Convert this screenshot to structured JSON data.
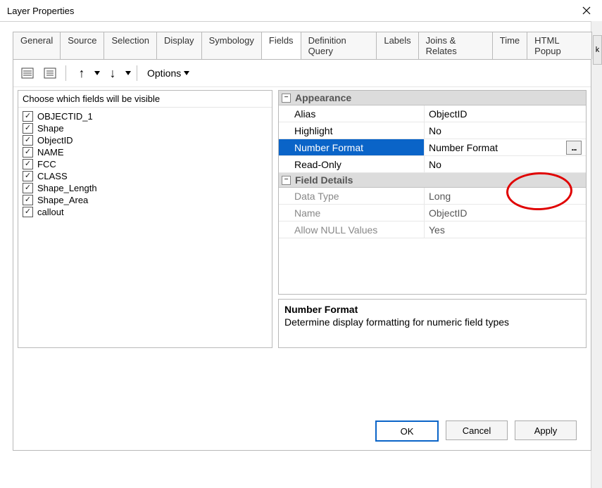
{
  "window": {
    "title": "Layer Properties"
  },
  "tabs": [
    "General",
    "Source",
    "Selection",
    "Display",
    "Symbology",
    "Fields",
    "Definition Query",
    "Labels",
    "Joins & Relates",
    "Time",
    "HTML Popup"
  ],
  "active_tab_index": 5,
  "toolbar": {
    "options_label": "Options"
  },
  "left": {
    "header": "Choose which fields will be visible",
    "fields": [
      {
        "checked": true,
        "name": "OBJECTID_1"
      },
      {
        "checked": true,
        "name": "Shape"
      },
      {
        "checked": true,
        "name": "ObjectID"
      },
      {
        "checked": true,
        "name": "NAME"
      },
      {
        "checked": true,
        "name": "FCC"
      },
      {
        "checked": true,
        "name": "CLASS"
      },
      {
        "checked": true,
        "name": "Shape_Length"
      },
      {
        "checked": true,
        "name": "Shape_Area"
      },
      {
        "checked": true,
        "name": "callout"
      }
    ]
  },
  "propgrid": {
    "groups": [
      {
        "title": "Appearance",
        "rows": [
          {
            "label": "Alias",
            "value": "ObjectID",
            "selected": false
          },
          {
            "label": "Highlight",
            "value": "No",
            "selected": false
          },
          {
            "label": "Number Format",
            "value": "Number Format",
            "selected": true,
            "has_ellipsis": true
          },
          {
            "label": "Read-Only",
            "value": "No",
            "selected": false
          }
        ]
      },
      {
        "title": "Field Details",
        "rows": [
          {
            "label": "Data Type",
            "value": "Long",
            "muted": true
          },
          {
            "label": "Name",
            "value": "ObjectID",
            "muted": true
          },
          {
            "label": "Allow NULL Values",
            "value": "Yes",
            "muted": true
          }
        ]
      }
    ]
  },
  "description": {
    "title": "Number Format",
    "text": "Determine display formatting for numeric field types"
  },
  "buttons": {
    "ok": "OK",
    "cancel": "Cancel",
    "apply": "Apply"
  }
}
